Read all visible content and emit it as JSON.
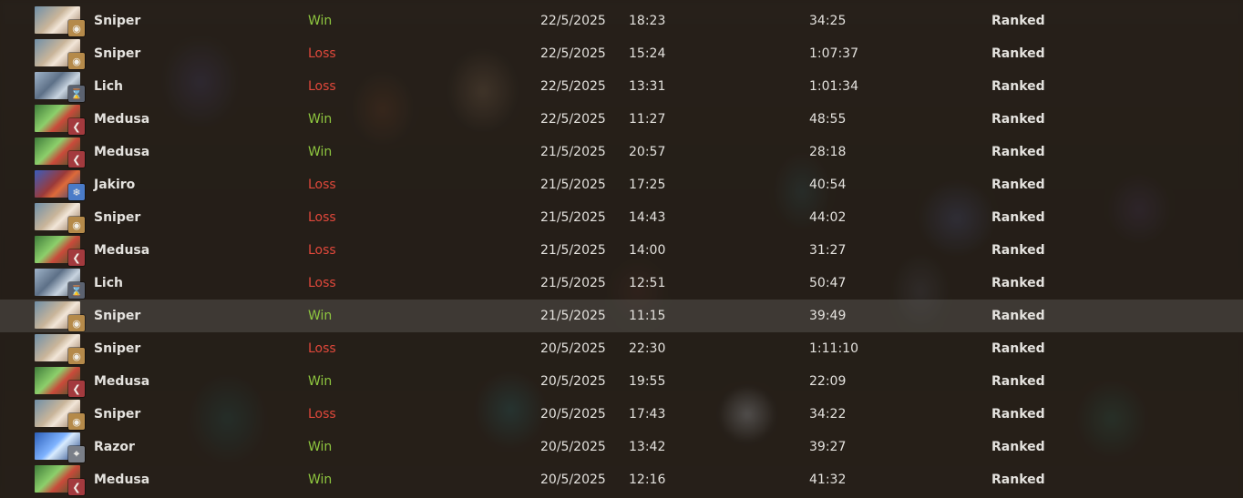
{
  "matches": [
    {
      "hero": "Sniper",
      "hero_key": "sniper",
      "facet_icon": "eye-icon",
      "facet_glyph": "◉",
      "result": "Win",
      "date": "22/5/2025",
      "time": "18:23",
      "duration": "34:25",
      "mode": "Ranked"
    },
    {
      "hero": "Sniper",
      "hero_key": "sniper",
      "facet_icon": "eye-icon",
      "facet_glyph": "◉",
      "result": "Loss",
      "date": "22/5/2025",
      "time": "15:24",
      "duration": "1:07:37",
      "mode": "Ranked"
    },
    {
      "hero": "Lich",
      "hero_key": "lich",
      "facet_icon": "hourglass-icon",
      "facet_glyph": "⌛",
      "result": "Loss",
      "date": "22/5/2025",
      "time": "13:31",
      "duration": "1:01:34",
      "mode": "Ranked"
    },
    {
      "hero": "Medusa",
      "hero_key": "medusa",
      "facet_icon": "chevron-left-icon",
      "facet_glyph": "❮",
      "result": "Win",
      "date": "22/5/2025",
      "time": "11:27",
      "duration": "48:55",
      "mode": "Ranked"
    },
    {
      "hero": "Medusa",
      "hero_key": "medusa",
      "facet_icon": "chevron-left-icon",
      "facet_glyph": "❮",
      "result": "Win",
      "date": "21/5/2025",
      "time": "20:57",
      "duration": "28:18",
      "mode": "Ranked"
    },
    {
      "hero": "Jakiro",
      "hero_key": "jakiro",
      "facet_icon": "snowflake-icon",
      "facet_glyph": "❄",
      "result": "Loss",
      "date": "21/5/2025",
      "time": "17:25",
      "duration": "40:54",
      "mode": "Ranked"
    },
    {
      "hero": "Sniper",
      "hero_key": "sniper",
      "facet_icon": "eye-icon",
      "facet_glyph": "◉",
      "result": "Loss",
      "date": "21/5/2025",
      "time": "14:43",
      "duration": "44:02",
      "mode": "Ranked"
    },
    {
      "hero": "Medusa",
      "hero_key": "medusa",
      "facet_icon": "chevron-left-icon",
      "facet_glyph": "❮",
      "result": "Loss",
      "date": "21/5/2025",
      "time": "14:00",
      "duration": "31:27",
      "mode": "Ranked"
    },
    {
      "hero": "Lich",
      "hero_key": "lich",
      "facet_icon": "hourglass-icon",
      "facet_glyph": "⌛",
      "result": "Loss",
      "date": "21/5/2025",
      "time": "12:51",
      "duration": "50:47",
      "mode": "Ranked"
    },
    {
      "hero": "Sniper",
      "hero_key": "sniper",
      "facet_icon": "eye-icon",
      "facet_glyph": "◉",
      "result": "Win",
      "date": "21/5/2025",
      "time": "11:15",
      "duration": "39:49",
      "mode": "Ranked",
      "highlighted": true
    },
    {
      "hero": "Sniper",
      "hero_key": "sniper",
      "facet_icon": "eye-icon",
      "facet_glyph": "◉",
      "result": "Loss",
      "date": "20/5/2025",
      "time": "22:30",
      "duration": "1:11:10",
      "mode": "Ranked"
    },
    {
      "hero": "Medusa",
      "hero_key": "medusa",
      "facet_icon": "chevron-left-icon",
      "facet_glyph": "❮",
      "result": "Win",
      "date": "20/5/2025",
      "time": "19:55",
      "duration": "22:09",
      "mode": "Ranked"
    },
    {
      "hero": "Sniper",
      "hero_key": "sniper",
      "facet_icon": "eye-icon",
      "facet_glyph": "◉",
      "result": "Loss",
      "date": "20/5/2025",
      "time": "17:43",
      "duration": "34:22",
      "mode": "Ranked"
    },
    {
      "hero": "Razor",
      "hero_key": "razor",
      "facet_icon": "target-icon",
      "facet_glyph": "⌖",
      "result": "Win",
      "date": "20/5/2025",
      "time": "13:42",
      "duration": "39:27",
      "mode": "Ranked"
    },
    {
      "hero": "Medusa",
      "hero_key": "medusa",
      "facet_icon": "chevron-left-icon",
      "facet_glyph": "❮",
      "result": "Win",
      "date": "20/5/2025",
      "time": "12:16",
      "duration": "41:32",
      "mode": "Ranked"
    }
  ],
  "colors": {
    "win": "#8ec63f",
    "loss": "#e0483b",
    "text": "#e4e2de"
  }
}
